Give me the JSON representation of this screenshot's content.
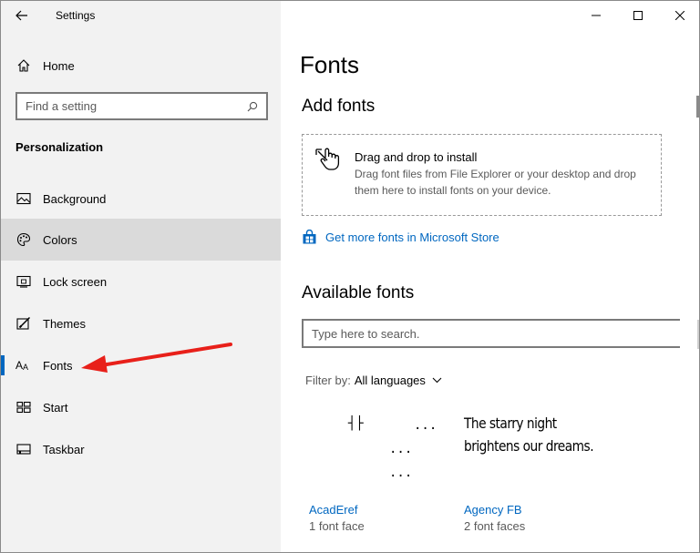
{
  "window": {
    "title": "Settings"
  },
  "sidebar": {
    "home_label": "Home",
    "search_placeholder": "Find a setting",
    "section_title": "Personalization",
    "items": [
      {
        "label": "Background",
        "icon": "picture-icon"
      },
      {
        "label": "Colors",
        "icon": "palette-icon"
      },
      {
        "label": "Lock screen",
        "icon": "lock-screen-icon"
      },
      {
        "label": "Themes",
        "icon": "themes-icon"
      },
      {
        "label": "Fonts",
        "icon": "fonts-icon"
      },
      {
        "label": "Start",
        "icon": "start-icon"
      },
      {
        "label": "Taskbar",
        "icon": "taskbar-icon"
      }
    ],
    "hovered_item": "Colors",
    "selected_item": "Fonts"
  },
  "main": {
    "page_title": "Fonts",
    "add_fonts": {
      "heading": "Add fonts",
      "drop_title": "Drag and drop to install",
      "drop_description": "Drag font files from File Explorer or your desktop and drop them here to install fonts on your device."
    },
    "store_link": "Get more fonts in Microsoft Store",
    "available_fonts": {
      "heading": "Available fonts",
      "search_placeholder": "Type here to search.",
      "filter_label": "Filter by:",
      "filter_value": "All languages",
      "fonts": [
        {
          "name": "AcadEref",
          "faces": "1 font face",
          "preview_lines": [
            "┤├",
            "...",
            "...",
            "..."
          ]
        },
        {
          "name": "Agency FB",
          "faces": "2 font faces",
          "preview_lines": [
            "The starry night",
            "brightens our dreams."
          ]
        }
      ]
    }
  },
  "colors": {
    "accent": "#0067c0",
    "sidebar_bg": "#f2f2f2",
    "hover_bg": "#dadada",
    "annotation_arrow": "#e8201a"
  }
}
